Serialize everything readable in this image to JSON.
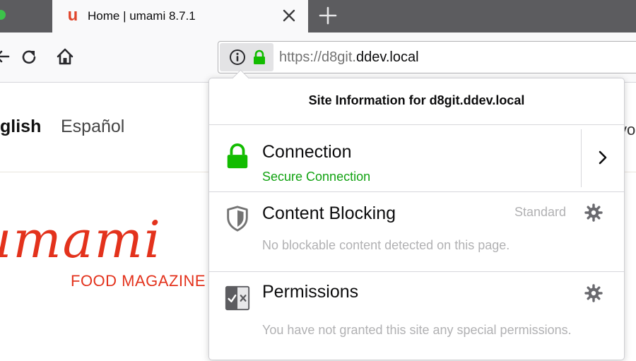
{
  "tabs": {
    "active_title": "Home | umami 8.7.1",
    "favicon": "u"
  },
  "navbar": {
    "url_prefix": "https://d8git.",
    "url_domain": "ddev.local"
  },
  "page": {
    "lang_english": "glish",
    "lang_espanol": "Español",
    "logo": "umami",
    "tagline": "FOOD MAGAZINE",
    "edge_text": "vo"
  },
  "panel": {
    "title": "Site Information for d8git.ddev.local",
    "connection": {
      "heading": "Connection",
      "status": "Secure Connection"
    },
    "content_blocking": {
      "heading": "Content Blocking",
      "level": "Standard",
      "description": "No blockable content detected on this page."
    },
    "permissions": {
      "heading": "Permissions",
      "description": "You have not granted this site any special permissions."
    }
  },
  "colors": {
    "secure_green": "#12a312",
    "brand_red": "#e3321c",
    "tab_strip": "#5c5c5f"
  }
}
